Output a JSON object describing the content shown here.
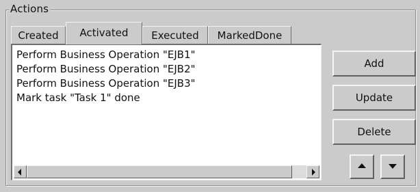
{
  "panel": {
    "title": "Actions"
  },
  "tabs": [
    {
      "label": "Created",
      "active": false
    },
    {
      "label": "Activated",
      "active": true
    },
    {
      "label": "Executed",
      "active": false
    },
    {
      "label": "MarkedDone",
      "active": false
    }
  ],
  "list": {
    "items": [
      "Perform Business Operation \"EJB1\"",
      "Perform Business Operation \"EJB2\"",
      "Perform Business Operation \"EJB3\"",
      "Mark task \"Task 1\" done"
    ]
  },
  "buttons": {
    "add": "Add",
    "update": "Update",
    "delete": "Delete"
  },
  "icons": {
    "move_up": "arrow-up-icon",
    "move_down": "arrow-down-icon",
    "scroll_left": "arrow-left-icon",
    "scroll_right": "arrow-right-icon"
  }
}
